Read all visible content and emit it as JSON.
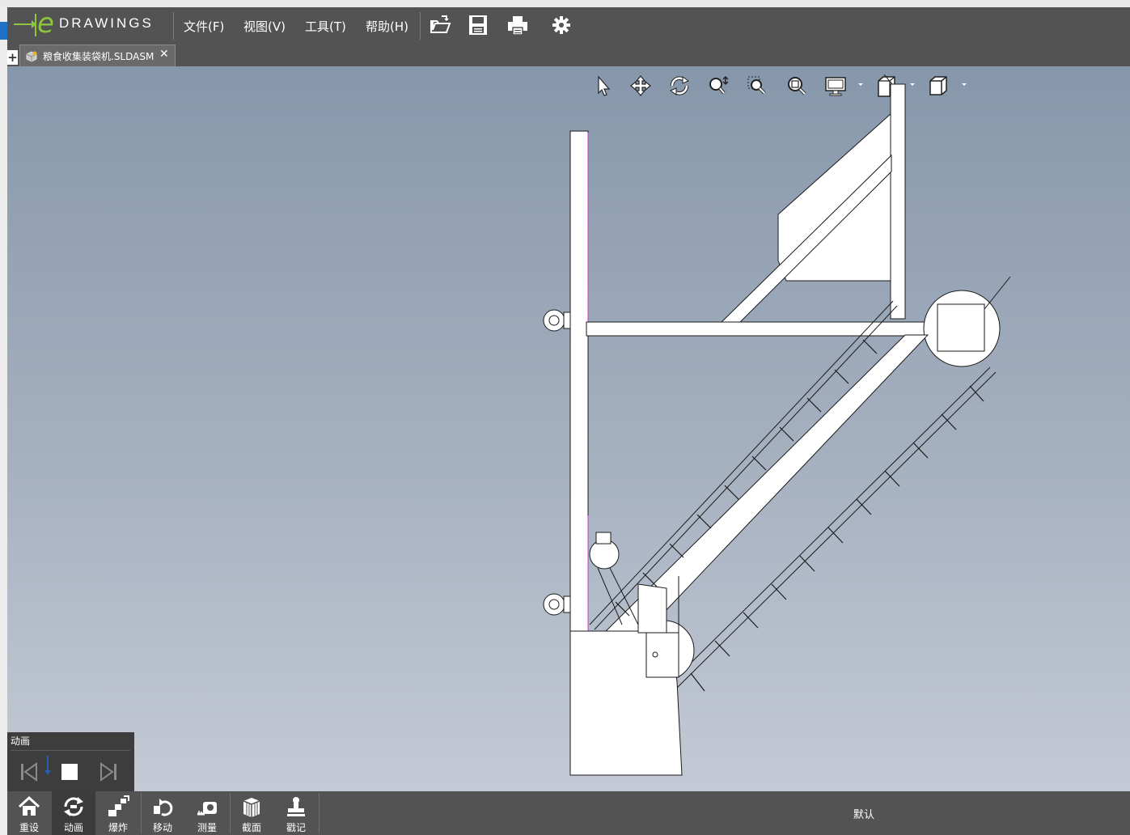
{
  "app": {
    "logo_text": "DRAWINGS"
  },
  "menu": {
    "file": "文件(F)",
    "view": "视图(V)",
    "tools": "工具(T)",
    "help": "帮助(H)"
  },
  "toolbar": {
    "icons": [
      "open-folder-icon",
      "save-icon",
      "print-icon",
      "gear-icon"
    ]
  },
  "tabs": {
    "plus": "+",
    "active_document": "粮食收集装袋机.SLDASM",
    "close": "✕"
  },
  "view_tools": [
    "select-pointer-icon",
    "pan-icon",
    "rotate-icon",
    "zoom-icon",
    "zoom-to-area-icon",
    "zoom-to-fit-icon",
    "display-style-icon",
    "section-view-icon",
    "view-orientation-icon"
  ],
  "animation_panel": {
    "title": "动画"
  },
  "bottom_tools": [
    {
      "label": "重设",
      "icon": "home-icon",
      "active": false
    },
    {
      "label": "动画",
      "icon": "animation-icon",
      "active": true
    },
    {
      "label": "爆炸",
      "icon": "explode-icon",
      "active": false
    },
    {
      "label": "移动",
      "icon": "move-icon",
      "active": false
    },
    {
      "label": "测量",
      "icon": "measure-icon",
      "active": false
    },
    {
      "label": "截面",
      "icon": "section-icon",
      "active": false
    },
    {
      "label": "戳记",
      "icon": "stamp-icon",
      "active": false
    }
  ],
  "configuration": "默认",
  "colors": {
    "menubar": "#535353",
    "logo_green": "#8cc63f",
    "viewport_top": "#8797ab",
    "viewport_bottom": "#c4cad5"
  }
}
